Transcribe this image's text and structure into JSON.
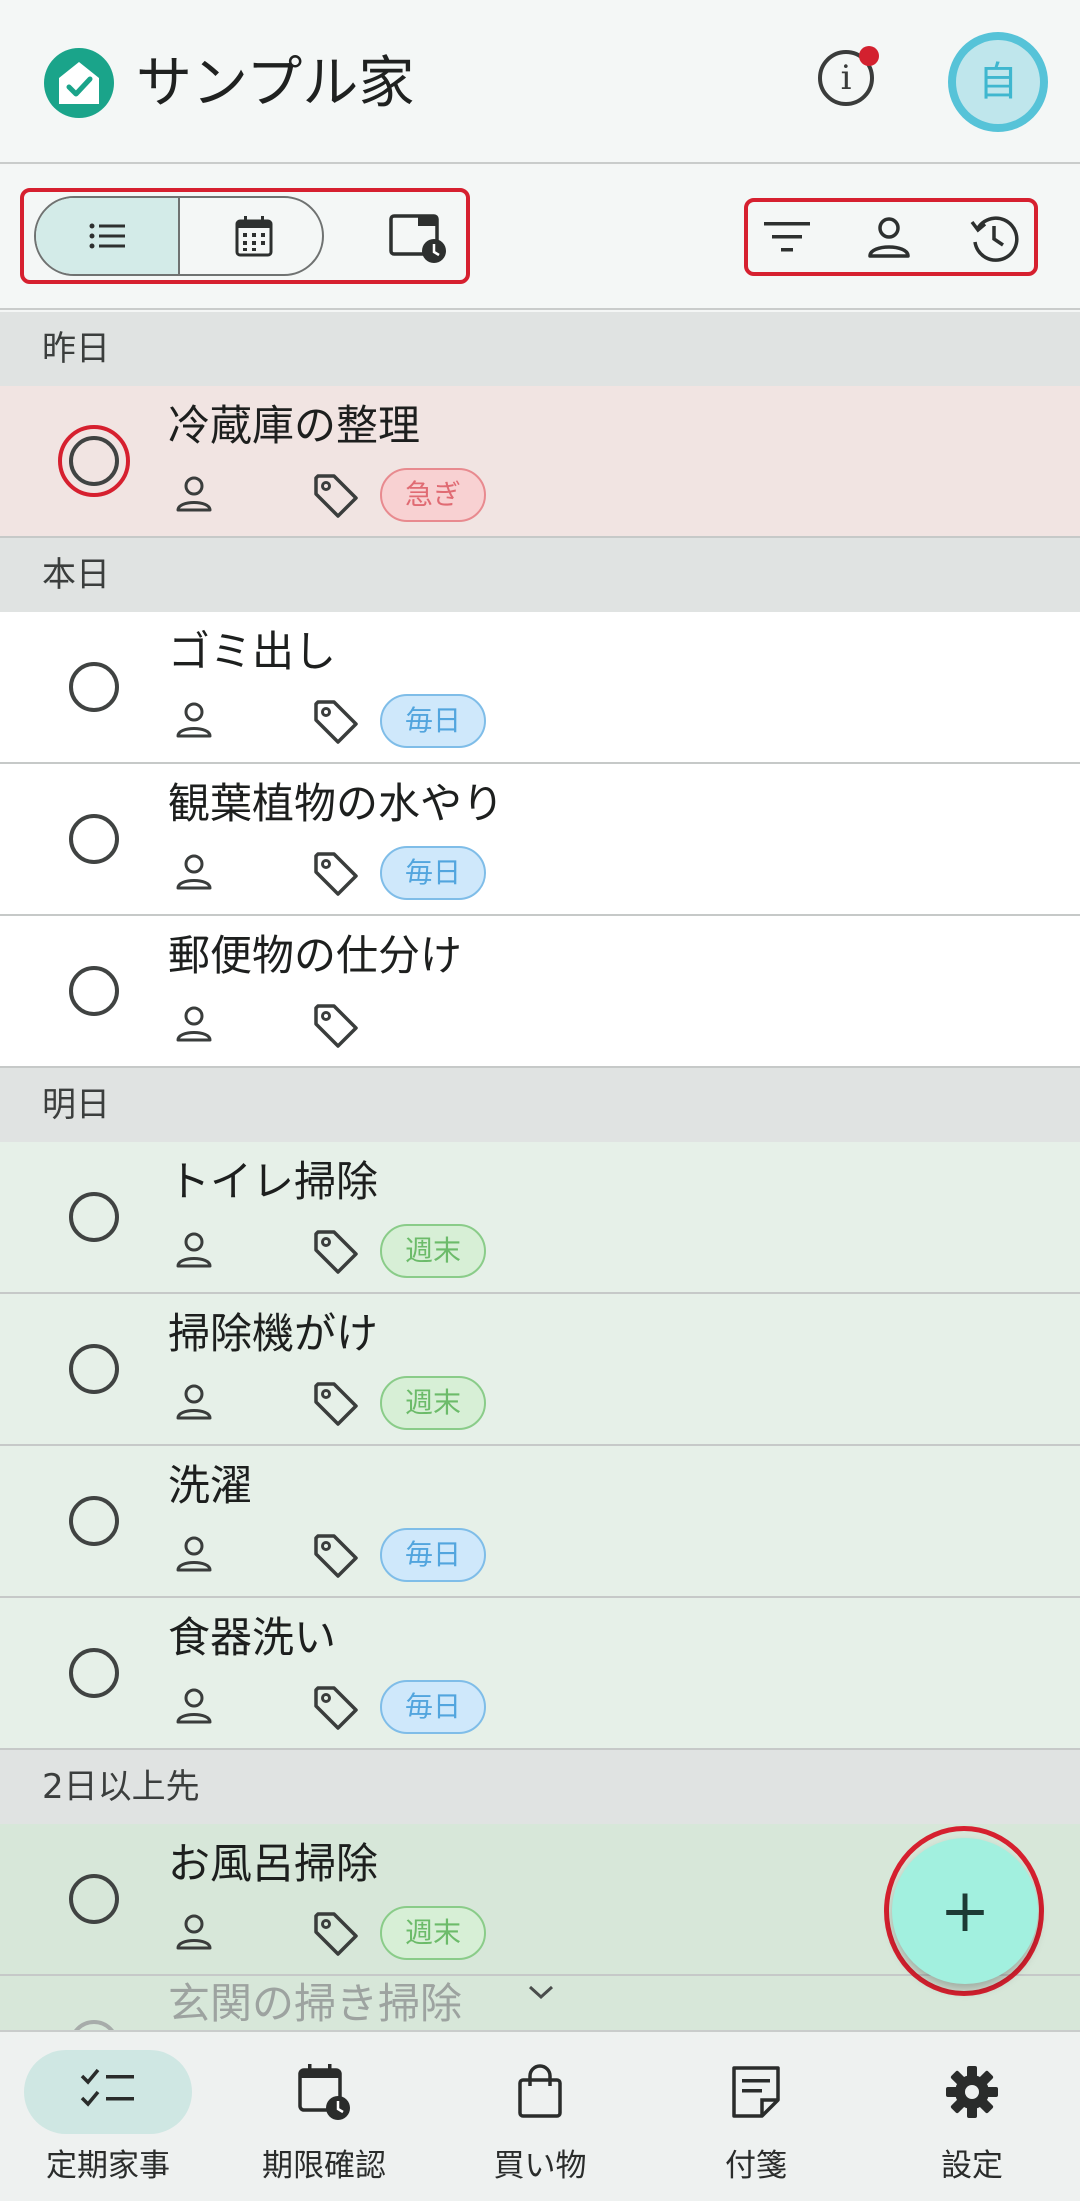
{
  "header": {
    "title": "サンプル家",
    "avatar_initial": "自",
    "info_icon": "info-icon",
    "notification_dot_color": "#d3212f"
  },
  "toolbar": {
    "view_modes": [
      "list-view-icon",
      "calendar-view-icon",
      "deadline-view-icon"
    ],
    "selected_view": "list-view-icon",
    "actions": [
      "filter-icon",
      "person-icon",
      "history-icon"
    ]
  },
  "sections": [
    {
      "label": "昨日",
      "tasks": [
        {
          "title": "冷蔵庫の整理",
          "badge": "急ぎ",
          "badge_type": "urgent"
        }
      ]
    },
    {
      "label": "本日",
      "tasks": [
        {
          "title": "ゴミ出し",
          "badge": "毎日",
          "badge_type": "daily"
        },
        {
          "title": "観葉植物の水やり",
          "badge": "毎日",
          "badge_type": "daily"
        },
        {
          "title": "郵便物の仕分け",
          "badge": "",
          "badge_type": ""
        }
      ]
    },
    {
      "label": "明日",
      "tasks": [
        {
          "title": "トイレ掃除",
          "badge": "週末",
          "badge_type": "weekend"
        },
        {
          "title": "掃除機がけ",
          "badge": "週末",
          "badge_type": "weekend"
        },
        {
          "title": "洗濯",
          "badge": "毎日",
          "badge_type": "daily"
        },
        {
          "title": "食器洗い",
          "badge": "毎日",
          "badge_type": "daily"
        }
      ]
    },
    {
      "label": "2日以上先",
      "tasks": [
        {
          "title": "お風呂掃除",
          "badge": "週末",
          "badge_type": "weekend"
        },
        {
          "title": "玄関の掃き掃除",
          "badge": "",
          "badge_type": ""
        }
      ]
    }
  ],
  "fab": {
    "label": "+"
  },
  "nav": [
    {
      "label": "定期家事",
      "icon": "checklist-icon",
      "active": true
    },
    {
      "label": "期限確認",
      "icon": "calendar-clock-icon",
      "active": false
    },
    {
      "label": "買い物",
      "icon": "shopping-bag-icon",
      "active": false
    },
    {
      "label": "付箋",
      "icon": "sticky-note-icon",
      "active": false
    },
    {
      "label": "設定",
      "icon": "settings-gear-icon",
      "active": false
    }
  ],
  "colors": {
    "accent": "#1aa48a",
    "highlight": "#d6202f",
    "fab": "#a2f0df"
  }
}
